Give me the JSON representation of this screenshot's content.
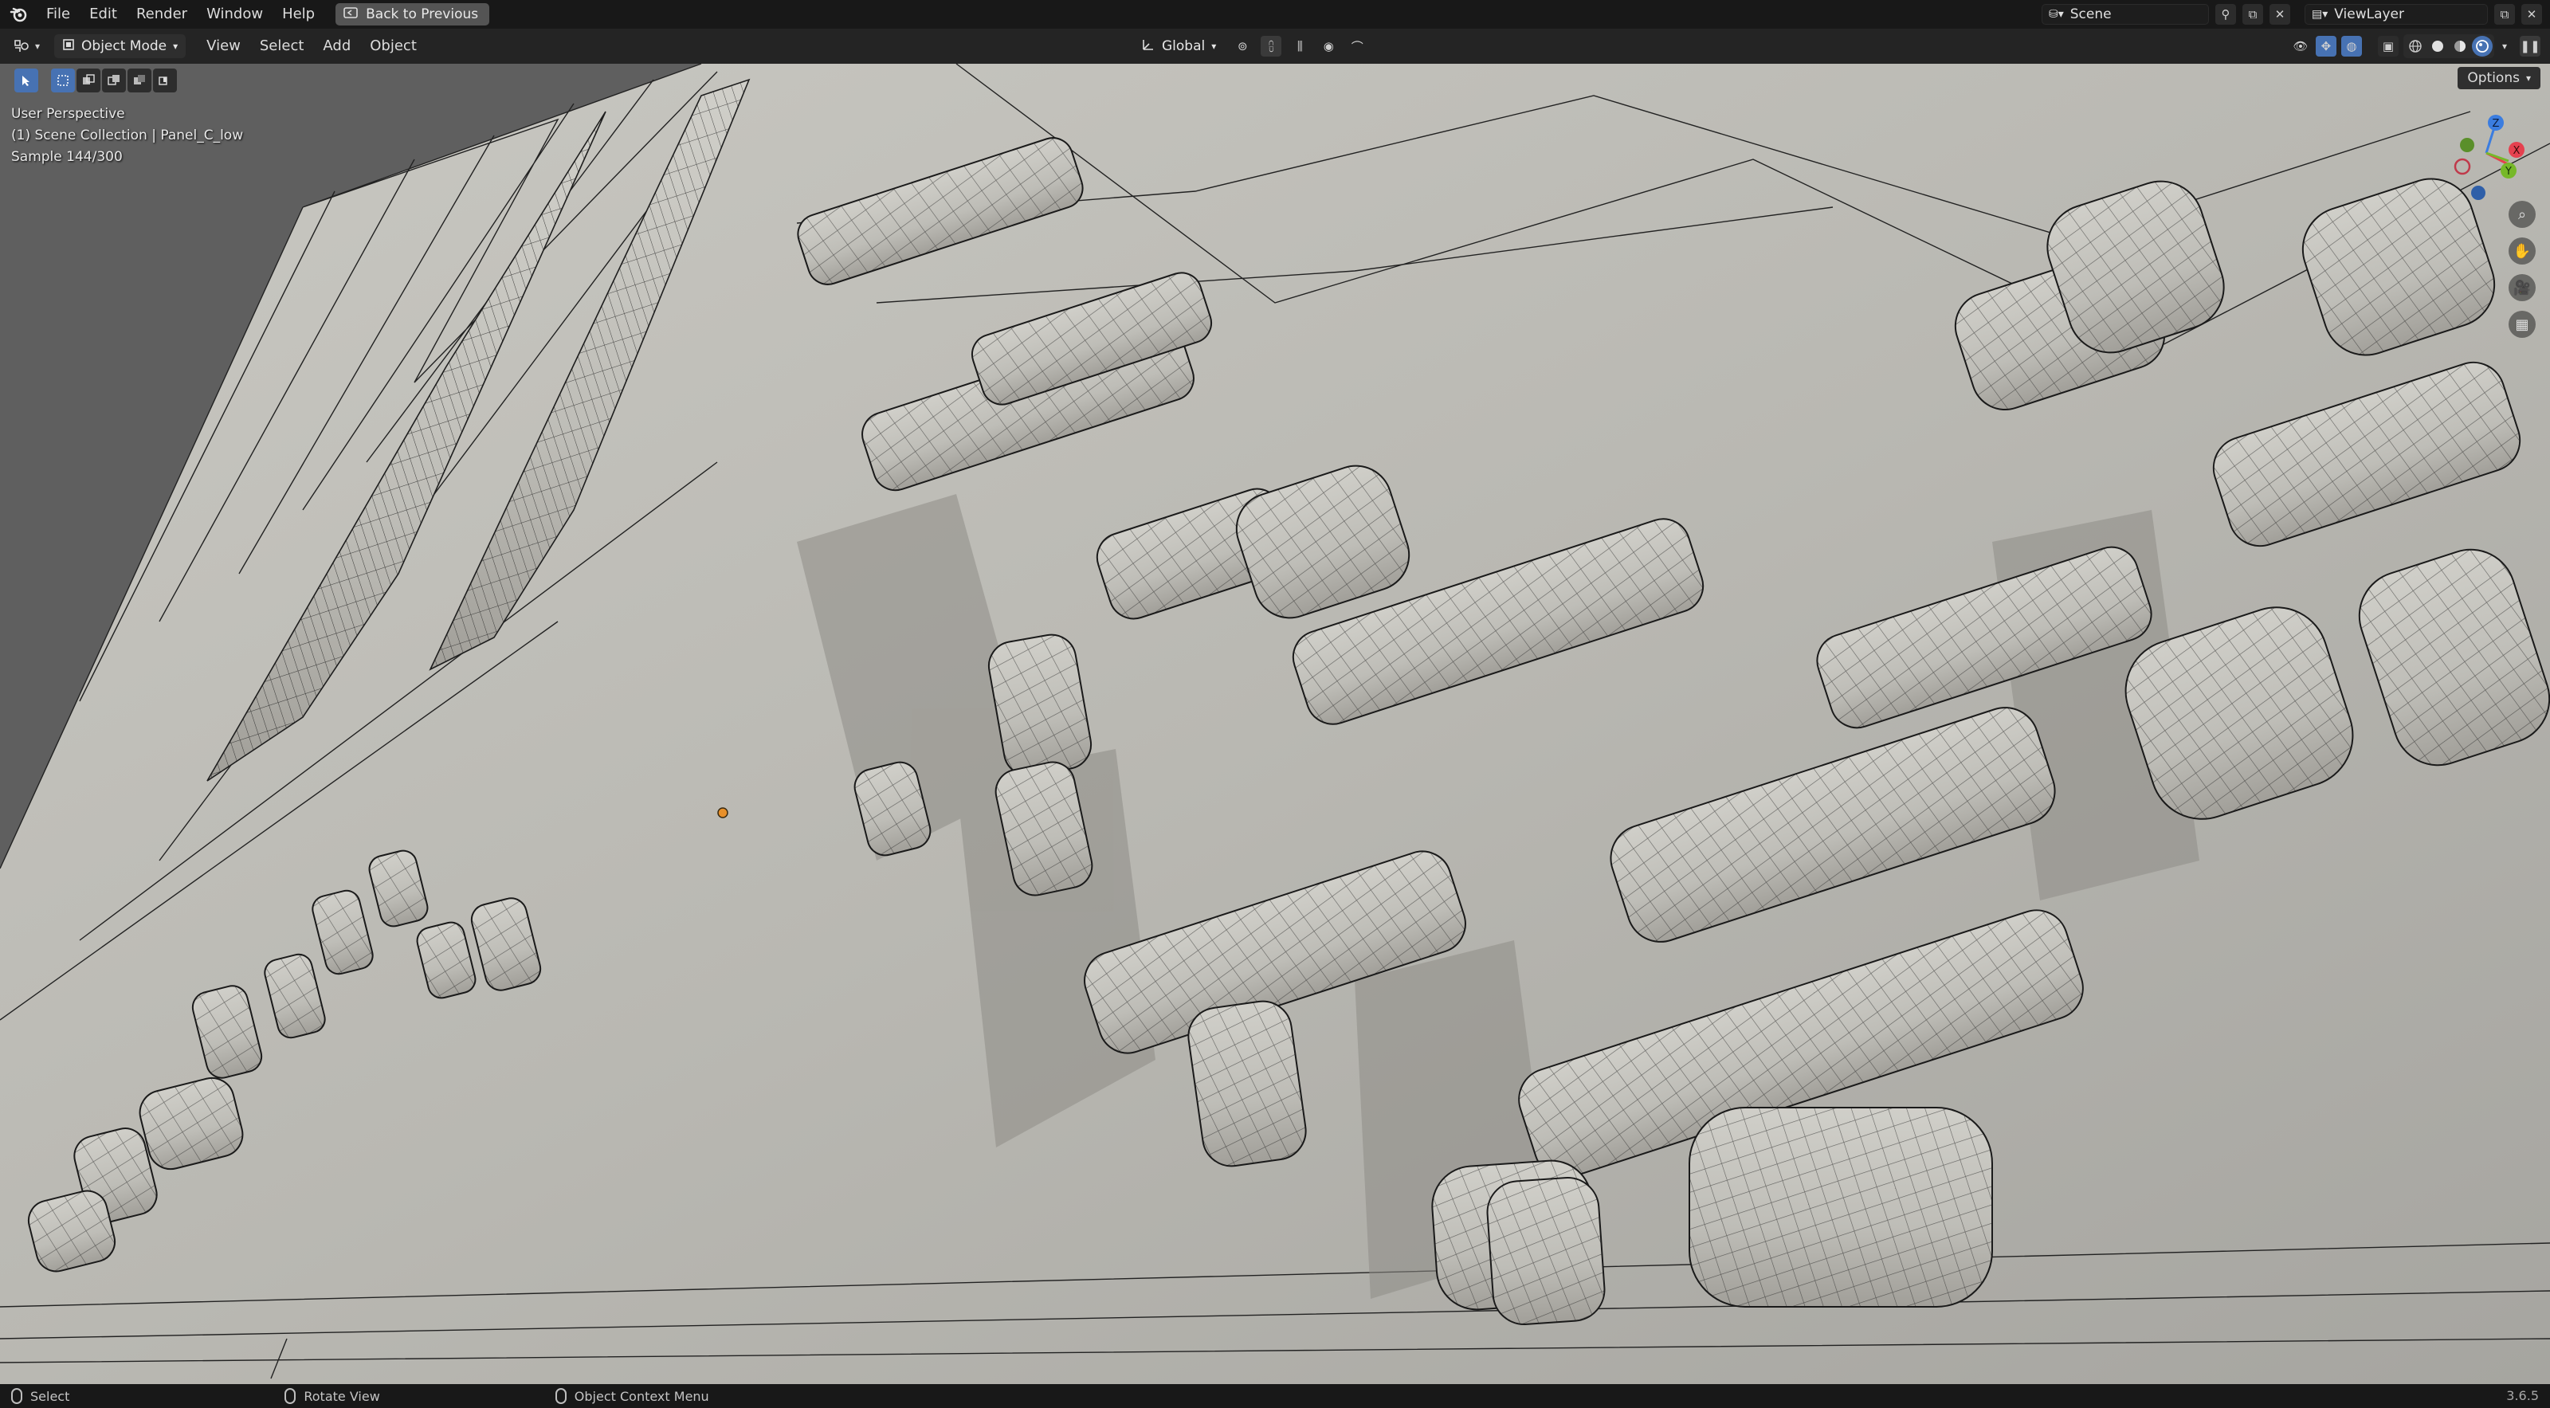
{
  "menu": {
    "items": [
      "File",
      "Edit",
      "Render",
      "Window",
      "Help"
    ],
    "back_button": "Back to Previous",
    "scene_name": "Scene",
    "view_layer": "ViewLayer"
  },
  "header": {
    "mode": "Object Mode",
    "menus": [
      "View",
      "Select",
      "Add",
      "Object"
    ],
    "transform_orientation": "Global"
  },
  "viewport": {
    "perspective": "User Perspective",
    "collection": "(1) Scene Collection | Panel_C_low",
    "sample": "Sample 144/300",
    "options_label": "Options",
    "gizmo_axes": {
      "x": "X",
      "y": "Y",
      "z": "Z"
    }
  },
  "status": {
    "select": "Select",
    "rotate": "Rotate View",
    "context": "Object Context Menu",
    "version": "3.6.5"
  },
  "colors": {
    "accent": "#4772b3",
    "x_axis": "#e5414f",
    "y_axis": "#76b829",
    "z_axis": "#3b7de0"
  },
  "icons": [
    "blender-logo-icon",
    "back-icon",
    "editor-type-icon",
    "object-mode-icon",
    "pin-icon",
    "new-scene-icon",
    "close-icon",
    "pivot-icon",
    "snap-icon",
    "proportional-icon",
    "gizmo-toggle-icon",
    "overlay-icon",
    "xray-icon",
    "wireframe-shading-icon",
    "solid-shading-icon",
    "material-shading-icon",
    "rendered-shading-icon",
    "select-box-icon",
    "zoom-icon",
    "hand-pan-icon",
    "camera-icon",
    "grid-icon",
    "mouse-icon"
  ]
}
